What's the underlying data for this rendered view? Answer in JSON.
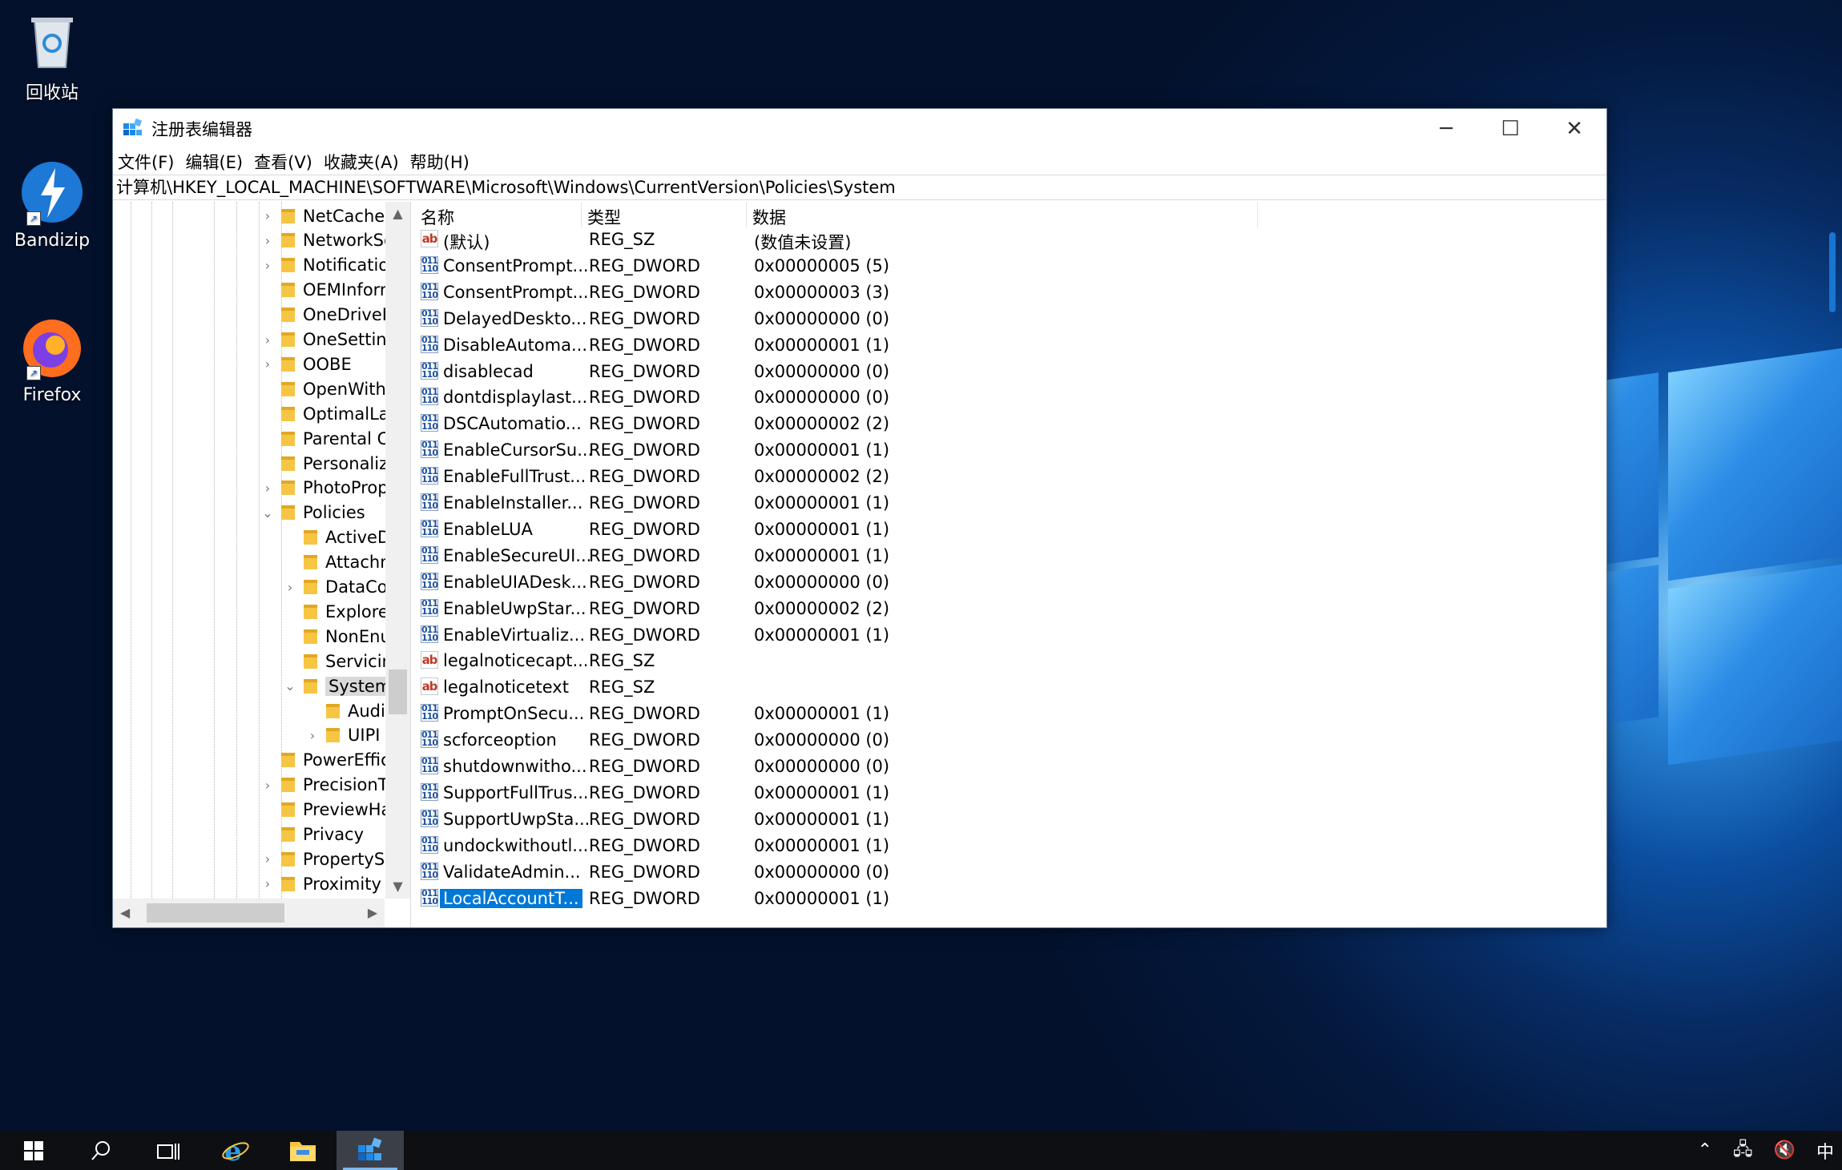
{
  "desktop": {
    "icons": [
      {
        "label": "回收站",
        "icon": "recycle-bin-icon"
      },
      {
        "label": "Bandizip",
        "icon": "bandizip-icon"
      },
      {
        "label": "Firefox",
        "icon": "firefox-icon"
      }
    ]
  },
  "window": {
    "title": "注册表编辑器",
    "minimize": "─",
    "maximize": "☐",
    "close": "✕"
  },
  "menu": [
    "文件(F)",
    "编辑(E)",
    "查看(V)",
    "收藏夹(A)",
    "帮助(H)"
  ],
  "address": "计算机\\HKEY_LOCAL_MACHINE\\SOFTWARE\\Microsoft\\Windows\\CurrentVersion\\Policies\\System",
  "tree": [
    {
      "label": "NetCache",
      "level": 0,
      "caret": "›"
    },
    {
      "label": "NetworkServi",
      "level": 0,
      "caret": "›"
    },
    {
      "label": "Notifications",
      "level": 0,
      "caret": "›"
    },
    {
      "label": "OEMInformat",
      "level": 0,
      "caret": ""
    },
    {
      "label": "OneDriveRan",
      "level": 0,
      "caret": ""
    },
    {
      "label": "OneSettings",
      "level": 0,
      "caret": "›"
    },
    {
      "label": "OOBE",
      "level": 0,
      "caret": "›"
    },
    {
      "label": "OpenWith",
      "level": 0,
      "caret": ""
    },
    {
      "label": "OptimalLayou",
      "level": 0,
      "caret": ""
    },
    {
      "label": "Parental Cont",
      "level": 0,
      "caret": ""
    },
    {
      "label": "Personalizatio",
      "level": 0,
      "caret": ""
    },
    {
      "label": "PhotoPropert",
      "level": 0,
      "caret": "›"
    },
    {
      "label": "Policies",
      "level": 0,
      "caret": "⌄"
    },
    {
      "label": "ActiveDesk",
      "level": 1,
      "caret": ""
    },
    {
      "label": "Attachmer",
      "level": 1,
      "caret": ""
    },
    {
      "label": "DataCollec",
      "level": 1,
      "caret": "›"
    },
    {
      "label": "Explorer",
      "level": 1,
      "caret": ""
    },
    {
      "label": "NonEnum",
      "level": 1,
      "caret": ""
    },
    {
      "label": "Servicing",
      "level": 1,
      "caret": ""
    },
    {
      "label": "System",
      "level": 1,
      "caret": "⌄",
      "selected": true
    },
    {
      "label": "Audit",
      "level": 2,
      "caret": ""
    },
    {
      "label": "UIPI",
      "level": 2,
      "caret": "›"
    },
    {
      "label": "PowerEfficien",
      "level": 0,
      "caret": ""
    },
    {
      "label": "PrecisionTouc",
      "level": 0,
      "caret": "›"
    },
    {
      "label": "PreviewHand",
      "level": 0,
      "caret": ""
    },
    {
      "label": "Privacy",
      "level": 0,
      "caret": ""
    },
    {
      "label": "PropertySyste",
      "level": 0,
      "caret": "›"
    },
    {
      "label": "Proximity",
      "level": 0,
      "caret": "›"
    }
  ],
  "list": {
    "headers": {
      "name": "名称",
      "type": "类型",
      "data": "数据"
    },
    "rows": [
      {
        "icon": "ab",
        "name": "(默认)",
        "type": "REG_SZ",
        "data": "(数值未设置)"
      },
      {
        "icon": "bin",
        "name": "ConsentPrompt...",
        "type": "REG_DWORD",
        "data": "0x00000005 (5)"
      },
      {
        "icon": "bin",
        "name": "ConsentPrompt...",
        "type": "REG_DWORD",
        "data": "0x00000003 (3)"
      },
      {
        "icon": "bin",
        "name": "DelayedDeskto...",
        "type": "REG_DWORD",
        "data": "0x00000000 (0)"
      },
      {
        "icon": "bin",
        "name": "DisableAutoma...",
        "type": "REG_DWORD",
        "data": "0x00000001 (1)"
      },
      {
        "icon": "bin",
        "name": "disablecad",
        "type": "REG_DWORD",
        "data": "0x00000000 (0)"
      },
      {
        "icon": "bin",
        "name": "dontdisplaylast...",
        "type": "REG_DWORD",
        "data": "0x00000000 (0)"
      },
      {
        "icon": "bin",
        "name": "DSCAutomatio...",
        "type": "REG_DWORD",
        "data": "0x00000002 (2)"
      },
      {
        "icon": "bin",
        "name": "EnableCursorSu...",
        "type": "REG_DWORD",
        "data": "0x00000001 (1)"
      },
      {
        "icon": "bin",
        "name": "EnableFullTrust...",
        "type": "REG_DWORD",
        "data": "0x00000002 (2)"
      },
      {
        "icon": "bin",
        "name": "EnableInstaller...",
        "type": "REG_DWORD",
        "data": "0x00000001 (1)"
      },
      {
        "icon": "bin",
        "name": "EnableLUA",
        "type": "REG_DWORD",
        "data": "0x00000001 (1)"
      },
      {
        "icon": "bin",
        "name": "EnableSecureUI...",
        "type": "REG_DWORD",
        "data": "0x00000001 (1)"
      },
      {
        "icon": "bin",
        "name": "EnableUIADesk...",
        "type": "REG_DWORD",
        "data": "0x00000000 (0)"
      },
      {
        "icon": "bin",
        "name": "EnableUwpStar...",
        "type": "REG_DWORD",
        "data": "0x00000002 (2)"
      },
      {
        "icon": "bin",
        "name": "EnableVirtualiz...",
        "type": "REG_DWORD",
        "data": "0x00000001 (1)"
      },
      {
        "icon": "ab",
        "name": "legalnoticecapt...",
        "type": "REG_SZ",
        "data": ""
      },
      {
        "icon": "ab",
        "name": "legalnoticetext",
        "type": "REG_SZ",
        "data": ""
      },
      {
        "icon": "bin",
        "name": "PromptOnSecu...",
        "type": "REG_DWORD",
        "data": "0x00000001 (1)"
      },
      {
        "icon": "bin",
        "name": "scforceoption",
        "type": "REG_DWORD",
        "data": "0x00000000 (0)"
      },
      {
        "icon": "bin",
        "name": "shutdownwitho...",
        "type": "REG_DWORD",
        "data": "0x00000000 (0)"
      },
      {
        "icon": "bin",
        "name": "SupportFullTrus...",
        "type": "REG_DWORD",
        "data": "0x00000001 (1)"
      },
      {
        "icon": "bin",
        "name": "SupportUwpSta...",
        "type": "REG_DWORD",
        "data": "0x00000001 (1)"
      },
      {
        "icon": "bin",
        "name": "undockwithoutl...",
        "type": "REG_DWORD",
        "data": "0x00000001 (1)"
      },
      {
        "icon": "bin",
        "name": "ValidateAdmin...",
        "type": "REG_DWORD",
        "data": "0x00000000 (0)"
      },
      {
        "icon": "bin",
        "name": "LocalAccountT...",
        "type": "REG_DWORD",
        "data": "0x00000001 (1)",
        "selected": true
      }
    ]
  },
  "taskbar": {
    "items": [
      "start-icon",
      "search-icon",
      "task-view-icon",
      "ie-icon",
      "file-explorer-icon",
      "regedit-icon"
    ],
    "tray_ime": "中"
  },
  "colors": {
    "selection": "#0078d7",
    "desktop": "#061e4a"
  }
}
